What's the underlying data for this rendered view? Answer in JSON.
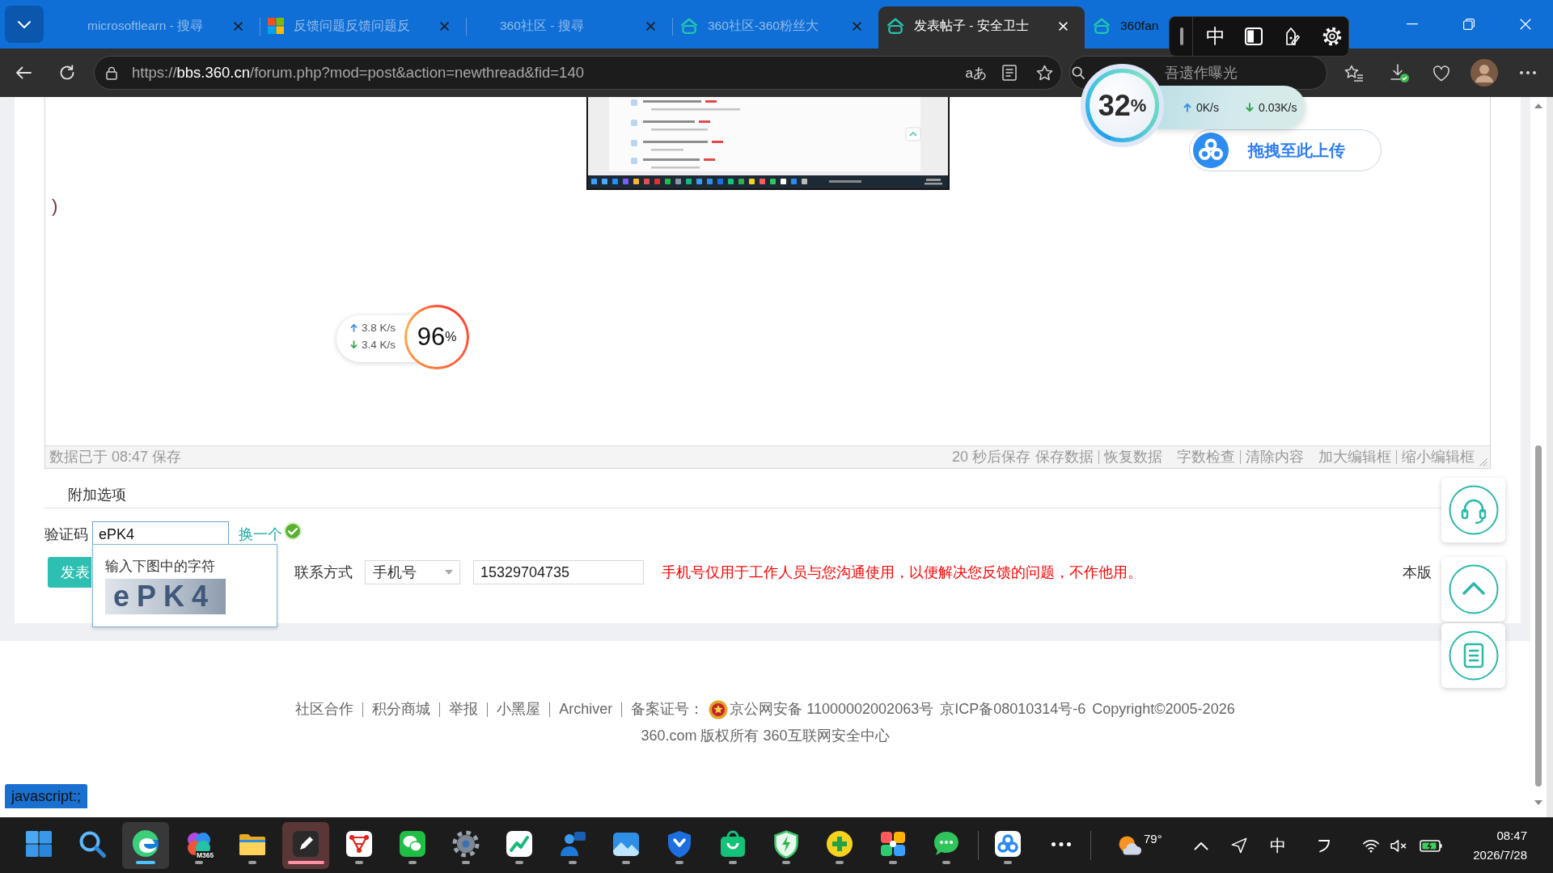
{
  "browser": {
    "tabs": [
      {
        "title": "microsoftlearn - 搜尋",
        "kind": "plain",
        "selected": false,
        "sleeping": true
      },
      {
        "title": "反馈问题反馈问题反",
        "kind": "microsoft",
        "selected": false,
        "sleeping": true
      },
      {
        "title": "360社区 - 搜尋",
        "kind": "plain",
        "selected": false,
        "sleeping": true
      },
      {
        "title": "360社区-360粉丝大",
        "kind": "house",
        "selected": false,
        "sleeping": true
      },
      {
        "title": "发表帖子 - 安全卫士",
        "kind": "house",
        "selected": true,
        "sleeping": false
      },
      {
        "title": "360fan",
        "kind": "house",
        "selected": false,
        "sleeping": false
      }
    ],
    "ime_bar": {
      "mode": "中"
    },
    "address": {
      "url": "https://**bbs.360.cn**/forum.php?mod=post&action=newthread&fid=140",
      "translate": "aあ"
    },
    "search": {
      "placeholder": "吾遗作曝光"
    }
  },
  "widgets": {
    "docked_ball": {
      "percent": "32",
      "unit": "%",
      "upload": "0K/s",
      "download": "0.03K/s"
    },
    "upload_drop": {
      "label": "拖拽至此上传"
    },
    "floating_ball": {
      "percent": "96",
      "unit": "%",
      "upload": "3.8 K/s",
      "download": "3.4 K/s"
    }
  },
  "page": {
    "editor": {
      "body_text": ")",
      "saved_note": "数据已于 08:47 保存",
      "autosave": "20 秒后保存",
      "action_groups": [
        [
          "保存数据",
          "恢复数据"
        ],
        [
          "字数检查",
          "清除内容"
        ],
        [
          "加大编辑框",
          "缩小编辑框"
        ]
      ]
    },
    "extra_options": "附加选项",
    "captcha": {
      "label": "验证码",
      "value": "ePK4",
      "refresh": "换一个",
      "verified": true,
      "hint": "输入下图中的字符",
      "image_text": "ePK4"
    },
    "submit": "发表",
    "contact": {
      "label": "联系方式",
      "method": "手机号",
      "phone": "15329704735",
      "notice": "手机号仅用于工作人员与您沟通使用，以便解决您反馈的问题，不作他用。"
    },
    "side_note": "本版",
    "side_buttons": [
      {
        "kind": "headset"
      },
      {
        "kind": "top"
      },
      {
        "kind": "list"
      }
    ],
    "footer": {
      "links": [
        "社区合作",
        "积分商城",
        "举报",
        "小黑屋",
        "Archiver"
      ],
      "record_label": "备案证号：",
      "police_record": "京公网安备 11000002002063号",
      "icp": "京ICP备08010314号-6",
      "copyright": "Copyright©2005-2026",
      "owner": "360.com 版权所有 360互联网安全中心"
    }
  },
  "status_link": "javascript:;",
  "taskbar": {
    "apps": [
      {
        "kind": "start",
        "running": false,
        "active": false,
        "attention": false
      },
      {
        "kind": "search",
        "running": false,
        "active": false,
        "attention": false
      },
      {
        "kind": "edge",
        "running": true,
        "active": true,
        "attention": false
      },
      {
        "kind": "m365",
        "running": true,
        "active": false,
        "attention": false,
        "badge": "M365"
      },
      {
        "kind": "folder",
        "running": true,
        "active": false,
        "attention": false
      },
      {
        "kind": "pen",
        "running": true,
        "active": false,
        "attention": true
      },
      {
        "kind": "network",
        "running": true,
        "active": false,
        "attention": false
      },
      {
        "kind": "wechat",
        "running": true,
        "active": false,
        "attention": false
      },
      {
        "kind": "gear",
        "running": true,
        "active": false,
        "attention": false
      },
      {
        "kind": "chart",
        "running": true,
        "active": false,
        "attention": false
      },
      {
        "kind": "people",
        "running": true,
        "active": false,
        "attention": false
      },
      {
        "kind": "photos",
        "running": true,
        "active": false,
        "attention": false
      },
      {
        "kind": "shield",
        "running": true,
        "active": false,
        "attention": false
      },
      {
        "kind": "bag",
        "running": true,
        "active": false,
        "attention": false
      },
      {
        "kind": "bolt",
        "running": true,
        "active": false,
        "attention": false
      },
      {
        "kind": "plus",
        "running": true,
        "active": false,
        "attention": false
      },
      {
        "kind": "flower",
        "running": true,
        "active": false,
        "attention": false
      },
      {
        "kind": "chat",
        "running": true,
        "active": false,
        "attention": false
      }
    ],
    "extra_apps": [
      {
        "kind": "cloud",
        "running": true,
        "active": false,
        "attention": false
      },
      {
        "kind": "more",
        "running": false,
        "active": false,
        "attention": false
      }
    ],
    "weather": "79°",
    "ime": "中",
    "time": "08:47",
    "date": "2026/7/28"
  }
}
